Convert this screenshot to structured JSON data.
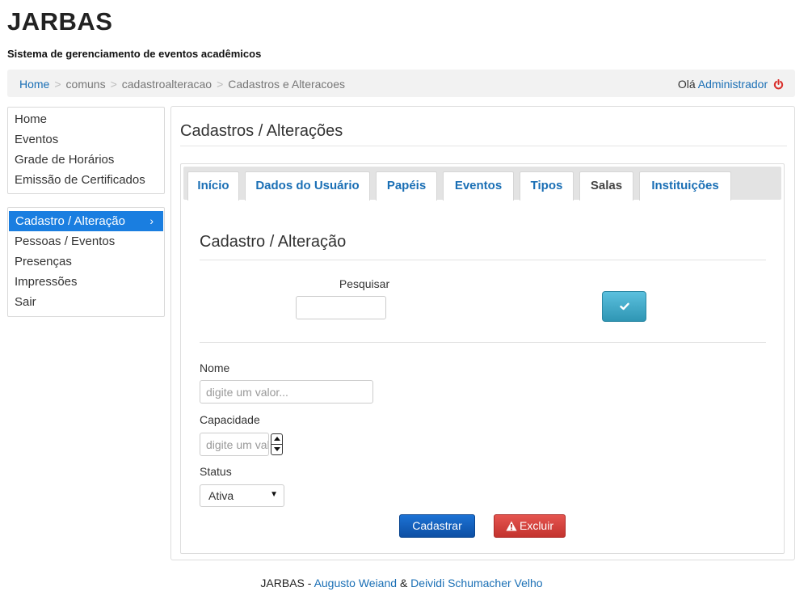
{
  "header": {
    "title": "JARBAS",
    "subtitle": "Sistema de gerenciamento de eventos acadêmicos"
  },
  "breadcrumb": {
    "items": [
      "Home",
      "comuns",
      "cadastroalteracao",
      "Cadastros e Alteracoes"
    ],
    "separator": ">"
  },
  "user": {
    "greeting": "Olá",
    "name": "Administrador",
    "logout_icon": "power-icon"
  },
  "sidebar": {
    "main_items": [
      {
        "label": "Home"
      },
      {
        "label": "Eventos"
      },
      {
        "label": "Grade de Horários"
      },
      {
        "label": "Emissão de Certificados"
      }
    ],
    "sub_items": [
      {
        "label": "Cadastro / Alteração",
        "active": true
      },
      {
        "label": "Pessoas / Eventos"
      },
      {
        "label": "Presenças"
      },
      {
        "label": "Impressões"
      },
      {
        "label": "Sair"
      }
    ],
    "active_chevron": "›"
  },
  "main": {
    "title": "Cadastros / Alterações",
    "tabs": [
      {
        "label": "Início"
      },
      {
        "label": "Dados do Usuário"
      },
      {
        "label": "Papéis"
      },
      {
        "label": "Eventos"
      },
      {
        "label": "Tipos"
      },
      {
        "label": "Salas",
        "selected": true
      },
      {
        "label": "Instituições"
      }
    ]
  },
  "form": {
    "title": "Cadastro / Alteração",
    "search_label": "Pesquisar",
    "search_value": "",
    "nome_label": "Nome",
    "nome_placeholder": "digite um valor...",
    "capacidade_label": "Capacidade",
    "capacidade_placeholder": "digite um valor...",
    "status_label": "Status",
    "status_value": "Ativa",
    "submit_label": "Cadastrar",
    "delete_label": "Excluir"
  },
  "footer": {
    "app": "JARBAS",
    "dash": "-",
    "author1": "Augusto Weiand",
    "amp": "&",
    "author2": "Deividi Schumacher Velho"
  },
  "colors": {
    "accent": "#1a7ee0",
    "link": "#1a6fb5",
    "info_button": "#3aa3c8",
    "primary_button": "#1565c0",
    "danger_button": "#d9443f",
    "logout": "#d9302c"
  }
}
